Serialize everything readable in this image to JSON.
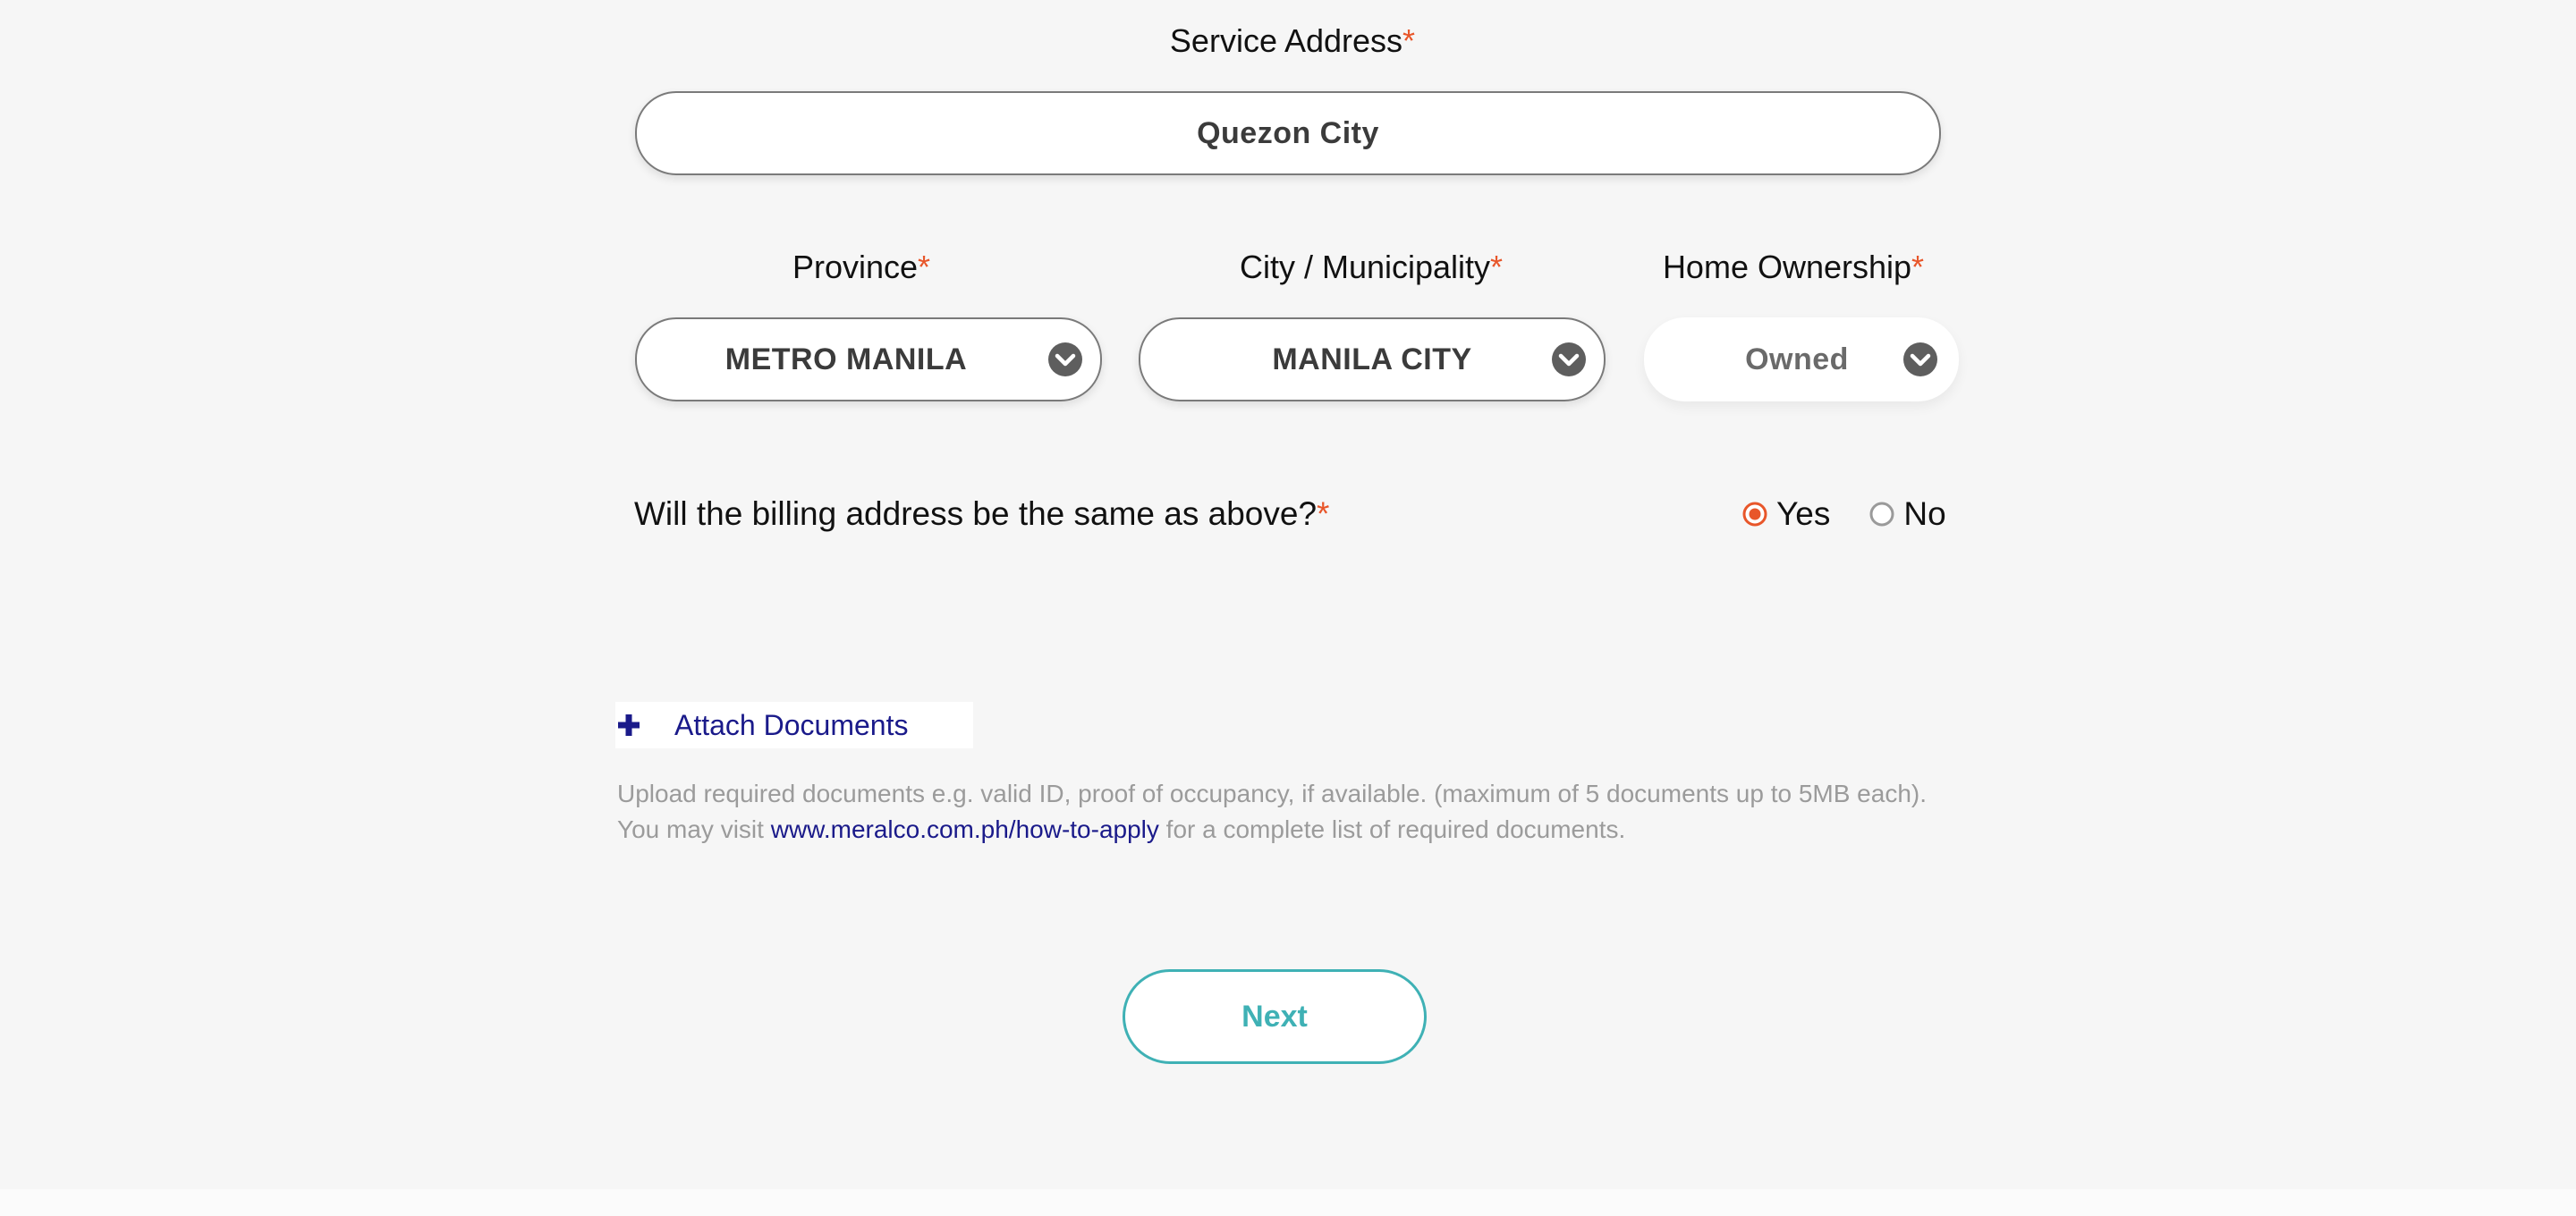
{
  "service_address": {
    "label": "Service Address",
    "required_mark": "*",
    "value": "Quezon City"
  },
  "province": {
    "label": "Province",
    "required_mark": "*",
    "value": "METRO MANILA",
    "icon": "chevron-down-icon"
  },
  "city": {
    "label": "City / Municipality",
    "required_mark": "*",
    "value": "MANILA CITY",
    "icon": "chevron-down-icon"
  },
  "ownership": {
    "label": "Home Ownership",
    "required_mark": "*",
    "value": "Owned",
    "icon": "chevron-down-icon"
  },
  "billing": {
    "question": "Will the billing address be the same as above?",
    "required_mark": "*",
    "options": [
      {
        "label": "Yes",
        "selected": true
      },
      {
        "label": "No",
        "selected": false
      }
    ]
  },
  "attach": {
    "label": "Attach Documents",
    "icon": "plus-icon"
  },
  "help": {
    "line1": "Upload required documents e.g. valid ID, proof of occupancy, if available. (maximum of 5 documents up to 5MB each).",
    "line2_prefix": "You may visit ",
    "link_text": "www.meralco.com.ph/how-to-apply",
    "line2_suffix": " for a complete list of required documents."
  },
  "next_button": {
    "label": "Next"
  },
  "colors": {
    "accent_required": "#e8562a",
    "link": "#1a1a8a",
    "button_teal": "#3fb1b5",
    "radio_selected": "#e8562a"
  }
}
